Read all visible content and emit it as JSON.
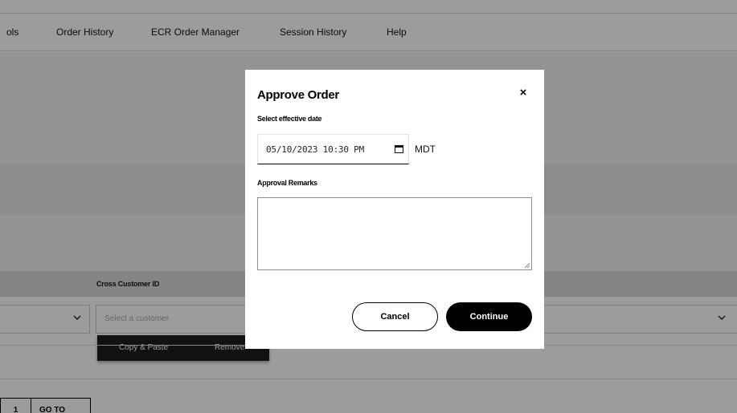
{
  "nav": {
    "items": [
      "ols",
      "Order History",
      "ECR Order Manager",
      "Session History",
      "Help"
    ]
  },
  "filters": {
    "cross_customer_label": "Cross Customer ID",
    "customer_placeholder": "Select a customer",
    "menu": {
      "copy_paste": "Copy & Paste",
      "remove": "Remove"
    }
  },
  "pager": {
    "page": "1",
    "goto_label": "GO TO"
  },
  "modal": {
    "title": "Approve Order",
    "close_symbol": "×",
    "date_label": "Select effective date",
    "date_value": "05/10/2023 10:30 PM",
    "timezone": "MDT",
    "remarks_label": "Approval Remarks",
    "remarks_value": "",
    "cancel_label": "Cancel",
    "continue_label": "Continue"
  },
  "icons": {
    "calendar": "calendar-icon",
    "chevron": "chevron-down-icon",
    "close": "close-icon"
  },
  "colors": {
    "primary_button": "#000000",
    "overlay": "rgba(0,0,0,0.39)"
  }
}
